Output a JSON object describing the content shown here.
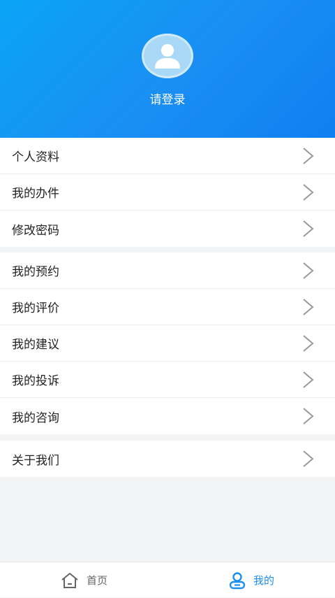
{
  "header": {
    "login_prompt": "请登录",
    "avatar_icon": "user-icon"
  },
  "groups": [
    {
      "items": [
        "个人资料",
        "我的办件",
        "修改密码"
      ]
    },
    {
      "items": [
        "我的预约",
        "我的评价",
        "我的建议",
        "我的投诉",
        "我的咨询"
      ]
    },
    {
      "items": [
        "关于我们"
      ]
    }
  ],
  "tabbar": {
    "items": [
      {
        "label": "首页",
        "icon": "home-icon",
        "active": false
      },
      {
        "label": "我的",
        "icon": "user-icon",
        "active": true
      }
    ]
  },
  "colors": {
    "brand": "#1a8ef3",
    "active_tab": "#1a8ef3",
    "inactive_tab": "#666666"
  }
}
